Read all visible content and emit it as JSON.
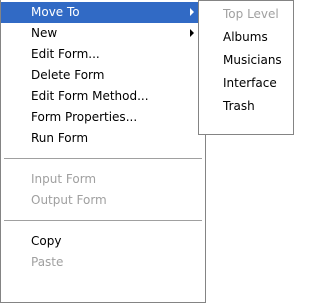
{
  "context_menu": {
    "move_to": "Move To",
    "new": "New",
    "edit_form": "Edit Form...",
    "delete_form": "Delete Form",
    "edit_form_method": "Edit Form Method...",
    "form_properties": "Form Properties...",
    "run_form": "Run Form",
    "input_form": "Input Form",
    "output_form": "Output Form",
    "copy": "Copy",
    "paste": "Paste"
  },
  "submenu": {
    "top_level": "Top Level",
    "albums": "Albums",
    "musicians": "Musicians",
    "interface": "Interface",
    "trash": "Trash"
  },
  "colors": {
    "selection": "#316ac5",
    "border": "#848484",
    "disabled_text": "#a0a0a0"
  }
}
